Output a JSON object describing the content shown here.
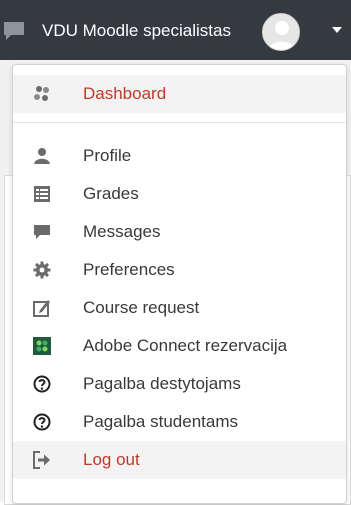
{
  "header": {
    "user_name": "VDU Moodle specialistas",
    "chat_icon": "chat-icon",
    "avatar": "user-avatar",
    "caret_icon": "caret-down-icon"
  },
  "colors": {
    "navbar": "#343a40",
    "accent_red": "#c0392b",
    "text": "#373a3c",
    "icon_gray": "#6b6b6b"
  },
  "menu": {
    "items": [
      {
        "label": "Dashboard",
        "icon": "dashboard-icon",
        "highlight": true
      },
      {
        "label": "Profile",
        "icon": "user-icon"
      },
      {
        "label": "Grades",
        "icon": "grades-table-icon"
      },
      {
        "label": "Messages",
        "icon": "message-bubble-icon"
      },
      {
        "label": "Preferences",
        "icon": "gear-icon"
      },
      {
        "label": "Course request",
        "icon": "edit-square-icon"
      },
      {
        "label": "Adobe Connect rezervacija",
        "icon": "adobe-connect-icon"
      },
      {
        "label": "Pagalba destytojams",
        "icon": "help-circle-icon"
      },
      {
        "label": "Pagalba studentams",
        "icon": "help-circle-icon"
      },
      {
        "label": "Log out",
        "icon": "logout-icon",
        "highlight": true
      }
    ]
  }
}
